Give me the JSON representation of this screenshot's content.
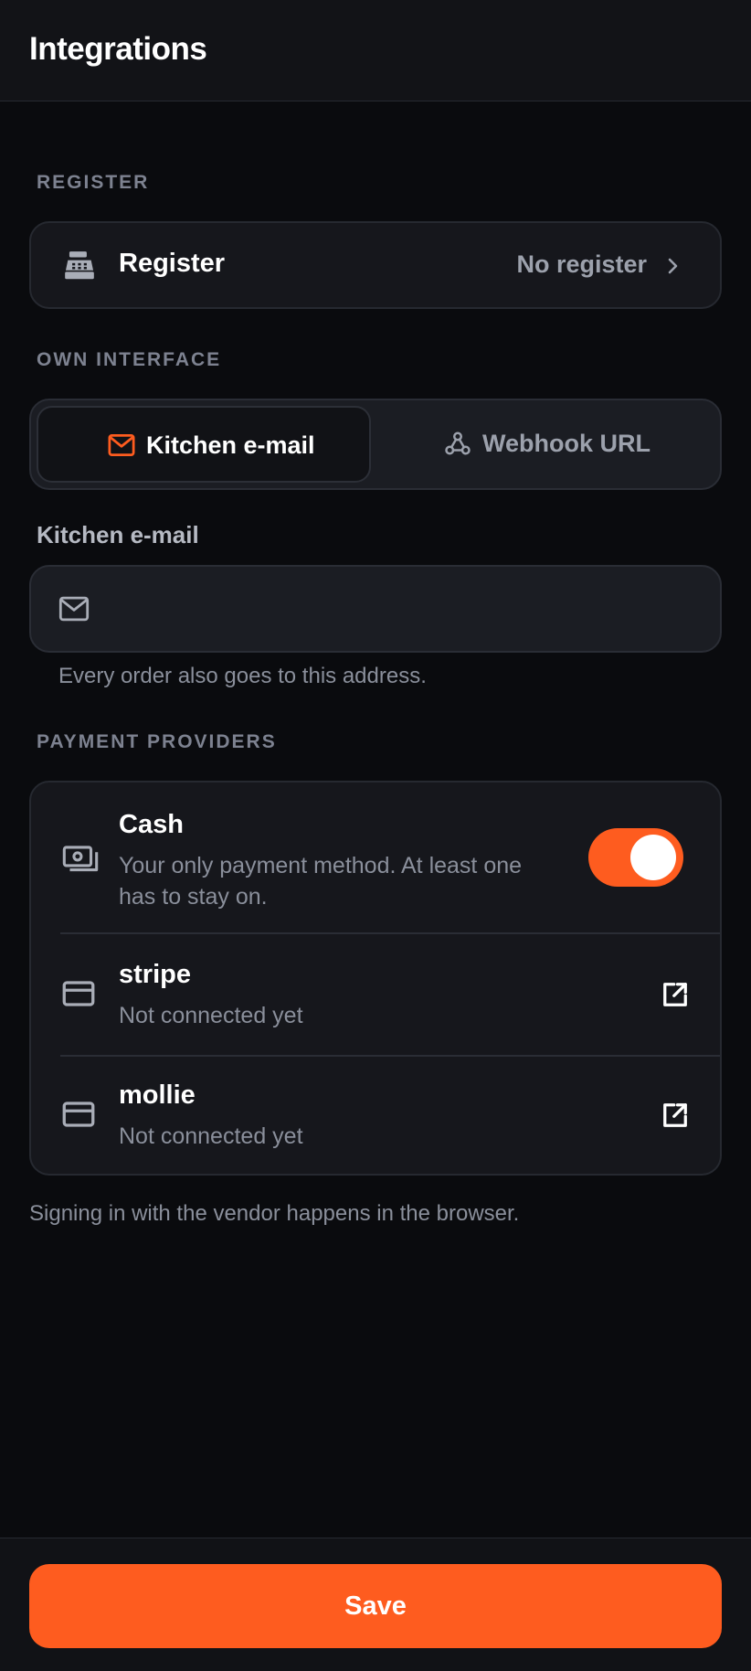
{
  "header": {
    "title": "Integrations"
  },
  "register_section": {
    "label": "REGISTER",
    "row": {
      "title": "Register",
      "value": "No register",
      "icon": "cash-register-icon"
    }
  },
  "interface_section": {
    "label": "OWN INTERFACE",
    "tabs": [
      {
        "label": "Kitchen e-mail",
        "icon": "mail-icon",
        "selected": true
      },
      {
        "label": "Webhook URL",
        "icon": "webhook-icon",
        "selected": false
      }
    ],
    "field": {
      "label": "Kitchen e-mail",
      "value": "",
      "placeholder": "",
      "helper": "Every order also goes to this address."
    }
  },
  "payment_section": {
    "label": "PAYMENT PROVIDERS",
    "providers": [
      {
        "name": "Cash",
        "description": "Your only payment method. At least one has to stay on.",
        "icon": "cash-icon",
        "enabled": true
      },
      {
        "name": "stripe",
        "description": "Not connected yet",
        "icon": "credit-card-icon",
        "action_icon": "external-link-icon"
      },
      {
        "name": "mollie",
        "description": "Not connected yet",
        "icon": "credit-card-icon",
        "action_icon": "external-link-icon"
      }
    ],
    "footnote": "Signing in with the vendor happens in the browser."
  },
  "footer": {
    "save_label": "Save"
  },
  "colors": {
    "accent": "#fe5c1f",
    "background": "#0a0b0e",
    "card": "#16171c",
    "muted_text": "#8a8f9b"
  }
}
